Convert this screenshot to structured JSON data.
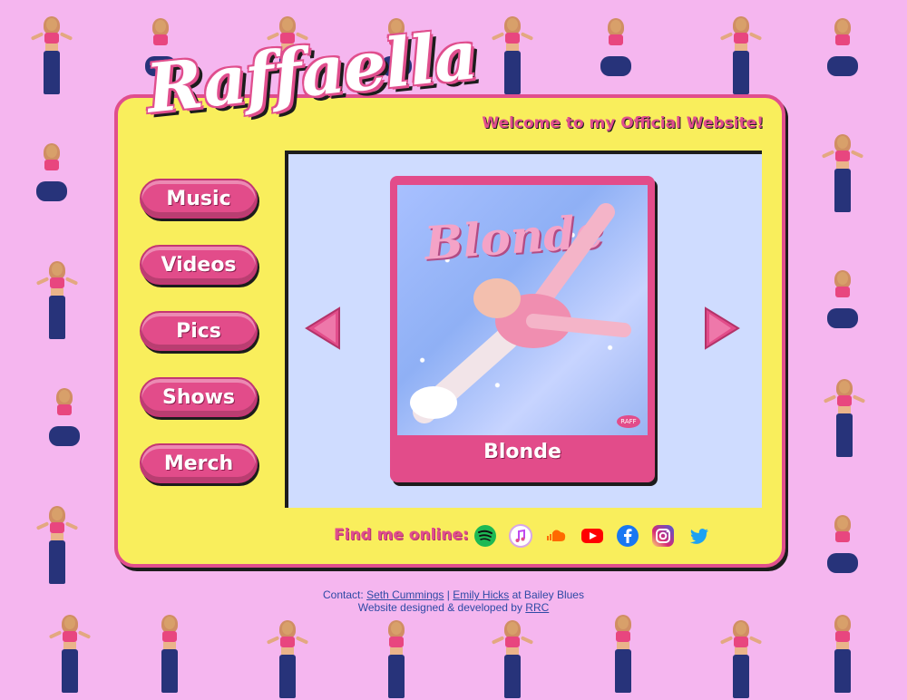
{
  "brand": {
    "logo_text": "Raffaella",
    "welcome": "Welcome to my Official Website!"
  },
  "nav": {
    "items": [
      "Music",
      "Videos",
      "Pics",
      "Shows",
      "Merch"
    ]
  },
  "carousel": {
    "current_title": "Blonde",
    "cover_title": "Blonde",
    "cover_badge": "RAFF"
  },
  "social": {
    "label": "Find me online:",
    "icons": [
      "spotify-icon",
      "apple-music-icon",
      "soundcloud-icon",
      "youtube-icon",
      "facebook-icon",
      "instagram-icon",
      "twitter-icon"
    ]
  },
  "footer": {
    "contact_prefix": "Contact:",
    "contact_1": "Seth Cummings",
    "separator": "|",
    "contact_2": "Emily Hicks",
    "contact_suffix": "at Bailey Blues",
    "credit_prefix": "Website designed & developed by",
    "credit_link": "RRC"
  },
  "colors": {
    "background": "#f5b6ef",
    "panel": "#f9ee5c",
    "accent": "#e24c8a",
    "stage": "#cfdcff",
    "link": "#2e4aa5"
  }
}
